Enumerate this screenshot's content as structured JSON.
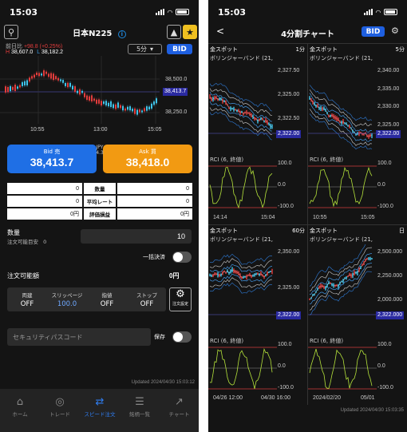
{
  "left": {
    "status": {
      "time": "15:03"
    },
    "title": "日本N225",
    "prev_label": "前日比",
    "change": "+98.8 (+0.25%)",
    "high_label": "H",
    "high": "38,607.0",
    "low_label": "L",
    "low": "38,182.2",
    "interval": "5分",
    "bid_toggle": "BID",
    "price_axis": [
      "38,500.0",
      "38,250.0"
    ],
    "current_price": "38,413.7",
    "time_axis": [
      "10:55",
      "13:00",
      "15:05"
    ],
    "bid": {
      "label": "Bid 売",
      "price": "38,413.7"
    },
    "spread": {
      "currency": "JPY",
      "value": "4.3"
    },
    "ask": {
      "label": "Ask 買",
      "price": "38,418.0"
    },
    "pos_table": {
      "labels": [
        "数量",
        "平均レート",
        "評価損益"
      ],
      "left_values": [
        "0",
        "0",
        "0円"
      ],
      "right_values": [
        "0",
        "0",
        "0円"
      ]
    },
    "qty": {
      "label": "数量",
      "sub_label": "注文可能目安",
      "sub_value": "0",
      "value": "10"
    },
    "bulk_settle": "一括決済",
    "available": {
      "label": "注文可能額",
      "value": "0円"
    },
    "settings": [
      {
        "label": "両建",
        "value": "OFF"
      },
      {
        "label": "スリッページ",
        "value": "100.0"
      },
      {
        "label": "指値",
        "value": "OFF"
      },
      {
        "label": "ストップ",
        "value": "OFF"
      }
    ],
    "order_settings": "注文設定",
    "security_placeholder": "セキュリティパスコード",
    "save_label": "保存",
    "updated": "Updated 2024/04/30 15:03:12",
    "tabs": [
      {
        "label": "ホーム",
        "icon": "home-icon"
      },
      {
        "label": "トレード",
        "icon": "trade-icon"
      },
      {
        "label": "スピード注文",
        "icon": "speed-order-icon"
      },
      {
        "label": "銘柄一覧",
        "icon": "list-icon"
      },
      {
        "label": "チャート",
        "icon": "chart-icon"
      }
    ]
  },
  "right": {
    "status": {
      "time": "15:03"
    },
    "back": "<",
    "title": "4分割チャート",
    "bid_toggle": "BID",
    "panes": [
      {
        "symbol": "金スポット",
        "interval": "1分",
        "indicator": "ボリンジャーバンド (21,",
        "osc": "RCI (6, 終値)",
        "prices": [
          "2,327.50",
          "2,325.00",
          "2,322.50"
        ],
        "current": "2,322.00",
        "rci": [
          "100.0",
          "0.0",
          "-100.0"
        ],
        "times": [
          "14:14",
          "15:04"
        ]
      },
      {
        "symbol": "金スポット",
        "interval": "5分",
        "indicator": "ボリンジャーバンド (21,",
        "osc": "RCI (6, 終値)",
        "prices": [
          "2,340.00",
          "2,335.00",
          "2,330.00",
          "2,325.00"
        ],
        "current": "2,322.00",
        "rci": [
          "100.0",
          "0.0",
          "-100.0"
        ],
        "times": [
          "10:55",
          "15:05"
        ]
      },
      {
        "symbol": "金スポット",
        "interval": "60分",
        "indicator": "ボリンジャーバンド (21,",
        "osc": "RCI (6, 終値)",
        "prices": [
          "2,350.00",
          "2,325.00"
        ],
        "current": "2,322.00",
        "rci": [
          "100.0",
          "0.0",
          "-100.0"
        ],
        "times": [
          "04/26 12:00",
          "04/30 16:00"
        ]
      },
      {
        "symbol": "金スポット",
        "interval": "日",
        "indicator": "ボリンジャーバンド (21,",
        "osc": "RCI (6, 終値)",
        "prices": [
          "2,500.000",
          "2,250.000",
          "2,000.000"
        ],
        "current": "2,322.000",
        "rci": [
          "100.0",
          "0.0",
          "-100.0"
        ],
        "times": [
          "2024/02/20",
          "05/01"
        ]
      }
    ],
    "updated": "Updated 2024/04/30 15:03:35"
  },
  "colors": {
    "accent": "#1e5fe0",
    "bid": "#1f6fe5",
    "ask": "#f29a12",
    "up": "#e23c3c",
    "down": "#3fc4ea",
    "rci": "#b5e33b"
  }
}
